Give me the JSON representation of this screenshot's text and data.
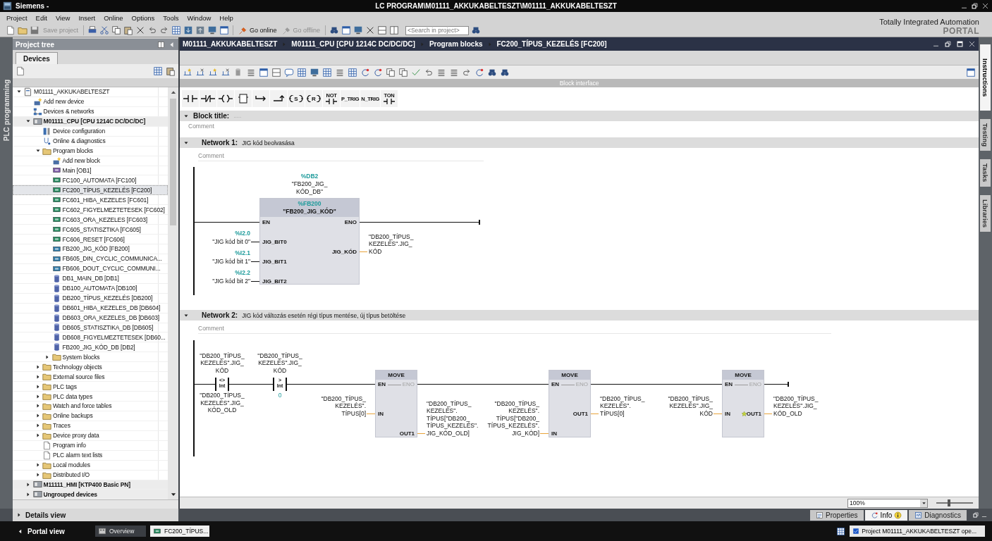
{
  "window": {
    "app": "Siemens -",
    "title": "LC PROGRAM\\M01111_AKKUKABELTESZT\\M01111_AKKUKABELTESZT"
  },
  "menu": [
    "Project",
    "Edit",
    "View",
    "Insert",
    "Online",
    "Options",
    "Tools",
    "Window",
    "Help"
  ],
  "toolbar": {
    "buttons": [
      {
        "label": "Save project",
        "disabled": true
      },
      {
        "label": "Go online",
        "disabled": false
      },
      {
        "label": "Go offline",
        "disabled": true
      }
    ],
    "search": {
      "placeholder": "<Search in project>"
    }
  },
  "brand": {
    "line1": "Totally Integrated Automation",
    "line2": "PORTAL"
  },
  "side_strip": "PLC programming",
  "project_tree": {
    "title": "Project tree",
    "tab": "Devices",
    "items": [
      {
        "label": "M01111_AKKUKABELTESZT",
        "kind": "project",
        "expanded": true,
        "selected": false,
        "children": [
          {
            "label": "Add new device",
            "kind": "add",
            "selected": false
          },
          {
            "label": "Devices & networks",
            "kind": "network",
            "selected": false
          },
          {
            "label": "M01111_CPU [CPU 1214C DC/DC/DC]",
            "kind": "device",
            "expanded": true,
            "selected": false,
            "children": [
              {
                "label": "Device configuration",
                "kind": "config",
                "selected": false
              },
              {
                "label": "Online & diagnostics",
                "kind": "diag",
                "selected": false
              },
              {
                "label": "Program blocks",
                "kind": "folder",
                "expanded": true,
                "selected": false,
                "children": [
                  {
                    "label": "Add new block",
                    "kind": "add",
                    "selected": false
                  },
                  {
                    "label": "Main [OB1]",
                    "kind": "ob",
                    "selected": false
                  },
                  {
                    "label": "FC100_AUTOMATA [FC100]",
                    "kind": "fc",
                    "selected": false
                  },
                  {
                    "label": "FC200_TÍPUS_KEZELÉS [FC200]",
                    "kind": "fc",
                    "selected": true
                  },
                  {
                    "label": "FC601_HIBA_KEZELES [FC601]",
                    "kind": "fc",
                    "selected": false
                  },
                  {
                    "label": "FC602_FIGYELMEZTETESEK [FC602]",
                    "kind": "fc",
                    "selected": false
                  },
                  {
                    "label": "FC603_ORA_KEZELES [FC603]",
                    "kind": "fc",
                    "selected": false
                  },
                  {
                    "label": "FC605_STATISZTIKA [FC605]",
                    "kind": "fc",
                    "selected": false
                  },
                  {
                    "label": "FC606_RESET [FC606]",
                    "kind": "fc",
                    "selected": false
                  },
                  {
                    "label": "FB200_JIG_KÓD [FB200]",
                    "kind": "fb",
                    "selected": false
                  },
                  {
                    "label": "FB605_DIN_CYCLIC_COMMUNICA...",
                    "kind": "fb",
                    "selected": false
                  },
                  {
                    "label": "FB606_DOUT_CYCLIC_COMMUNI...",
                    "kind": "fb",
                    "selected": false
                  },
                  {
                    "label": "DB1_MAIN_DB [DB1]",
                    "kind": "db",
                    "selected": false
                  },
                  {
                    "label": "DB100_AUTOMATA [DB100]",
                    "kind": "db",
                    "selected": false
                  },
                  {
                    "label": "DB200_TÍPUS_KEZELÉS [DB200]",
                    "kind": "db",
                    "selected": false
                  },
                  {
                    "label": "DB601_HIBA_KEZELES_DB [DB604]",
                    "kind": "db",
                    "selected": false
                  },
                  {
                    "label": "DB603_ORA_KEZELES_DB [DB603]",
                    "kind": "db",
                    "selected": false
                  },
                  {
                    "label": "DB605_STATISZTIKA_DB [DB605]",
                    "kind": "db",
                    "selected": false
                  },
                  {
                    "label": "DB608_FIGYELMEZTETESEK [DB60...",
                    "kind": "db",
                    "selected": false
                  },
                  {
                    "label": "FB200_JIG_KÓD_DB [DB2]",
                    "kind": "db",
                    "selected": false
                  },
                  {
                    "label": "System blocks",
                    "kind": "folder",
                    "expanded": false,
                    "selected": false
                  }
                ]
              },
              {
                "label": "Technology objects",
                "kind": "folder",
                "expanded": false,
                "selected": false
              },
              {
                "label": "External source files",
                "kind": "folder",
                "expanded": false,
                "selected": false
              },
              {
                "label": "PLC tags",
                "kind": "folder",
                "expanded": false,
                "selected": false
              },
              {
                "label": "PLC data types",
                "kind": "folder",
                "expanded": false,
                "selected": false
              },
              {
                "label": "Watch and force tables",
                "kind": "folder",
                "expanded": false,
                "selected": false
              },
              {
                "label": "Online backups",
                "kind": "folder",
                "expanded": false,
                "selected": false
              },
              {
                "label": "Traces",
                "kind": "folder",
                "expanded": false,
                "selected": false
              },
              {
                "label": "Device proxy data",
                "kind": "folder",
                "expanded": false,
                "selected": false
              },
              {
                "label": "Program info",
                "kind": "doc",
                "selected": false
              },
              {
                "label": "PLC alarm text lists",
                "kind": "doc",
                "selected": false
              },
              {
                "label": "Local modules",
                "kind": "folder",
                "expanded": false,
                "selected": false
              },
              {
                "label": "Distributed I/O",
                "kind": "folder",
                "expanded": false,
                "selected": false
              }
            ]
          },
          {
            "label": "M11111_HMI [KTP400 Basic PN]",
            "kind": "device",
            "expanded": false,
            "selected": false
          },
          {
            "label": "Ungrouped devices",
            "kind": "group",
            "expanded": false,
            "selected": false
          }
        ]
      }
    ],
    "details_view": {
      "label": "Details view",
      "expanded": false
    }
  },
  "editor": {
    "breadcrumb": [
      "M01111_AKKUKABELTESZT",
      "M01111_CPU [CPU 1214C DC/DC/DC]",
      "Program blocks",
      "FC200_TÍPUS_KEZELÉS [FC200]"
    ],
    "block_interface": "Block interface",
    "favorites": [
      {
        "kind": "contact_no"
      },
      {
        "kind": "contact_nc"
      },
      {
        "kind": "coil"
      },
      {
        "kind": "empty_box"
      },
      {
        "kind": "open_branch"
      },
      {
        "kind": "close_branch"
      },
      {
        "kind": "set_coil",
        "label": "S"
      },
      {
        "kind": "reset_coil",
        "label": "R"
      },
      {
        "kind": "not",
        "label": "NOT"
      },
      {
        "kind": "p_trig",
        "label": "P_TRIG"
      },
      {
        "kind": "n_trig",
        "label": "N_TRIG"
      },
      {
        "kind": "ton",
        "label": "TON"
      }
    ],
    "block_title": {
      "label": "Block title:",
      "value": ".....",
      "expanded": true,
      "comment": {
        "placeholder": "Comment"
      }
    },
    "networks": [
      {
        "label": "Network 1:",
        "title": "JIG kód beolvasása",
        "expanded": true,
        "comment": {
          "placeholder": "Comment"
        },
        "elements": [
          {
            "kind": "fb_box",
            "address": "%FB200",
            "name": "\"FB200_JIG_KÓD\"",
            "instance": {
              "address": "%DB2",
              "lines": [
                "\"FB200_JIG_",
                "KÓD_DB\""
              ]
            },
            "inputs": [
              {
                "pin": "EN"
              },
              {
                "pin": "JIG_BIT0",
                "operand": {
                  "address": "%I2.0",
                  "lines": [
                    "\"JIG kód bit 0\""
                  ],
                  "kind": "bool"
                }
              },
              {
                "pin": "JIG_BIT1",
                "operand": {
                  "address": "%I2.1",
                  "lines": [
                    "\"JIG kód bit 1\""
                  ],
                  "kind": "bool"
                }
              },
              {
                "pin": "JIG_BIT2",
                "operand": {
                  "address": "%I2.2",
                  "lines": [
                    "\"JIG kód bit 2\""
                  ],
                  "kind": "bool"
                }
              }
            ],
            "outputs": [
              {
                "pin": "ENO",
                "disabled": false
              },
              {
                "pin": "JIG_KÓD",
                "operand": {
                  "lines": [
                    "\"DB200_TÍPUS_",
                    "KEZELÉS\".JIG_",
                    "KÓD"
                  ],
                  "kind": "int"
                }
              }
            ]
          }
        ]
      },
      {
        "label": "Network 2:",
        "title": "JIG kód változás esetén régi típus mentése, új típus betöltése",
        "expanded": true,
        "comment": {
          "placeholder": "Comment"
        },
        "elements": [
          {
            "kind": "compare",
            "op": "<>",
            "type": "Int",
            "top": {
              "lines": [
                "\"DB200_TÍPUS_",
                "KEZELÉS\".JIG_",
                "KÓD"
              ],
              "kind": "tag"
            },
            "bottom": {
              "lines": [
                "\"DB200_TÍPUS_",
                "KEZELÉS\".JIG_",
                "KÓD_OLD"
              ],
              "kind": "tag"
            }
          },
          {
            "kind": "compare",
            "op": ">",
            "type": "Int",
            "top": {
              "lines": [
                "\"DB200_TÍPUS_",
                "KEZELÉS\".JIG_",
                "KÓD"
              ],
              "kind": "tag"
            },
            "bottom": {
              "lines": [
                "0"
              ],
              "kind": "constant"
            }
          },
          {
            "kind": "move_box",
            "title": "MOVE",
            "inputs": [
              {
                "pin": "EN"
              },
              {
                "pin": "IN",
                "operand": {
                  "lines": [
                    "\"DB200_TÍPUS_",
                    "KEZELÉS\".",
                    "TÍPUS[0]"
                  ],
                  "kind": "int"
                }
              }
            ],
            "outputs": [
              {
                "pin": "ENO",
                "disabled": true
              },
              {
                "pin": "OUT1",
                "operand": {
                  "lines": [
                    "\"DB200_TÍPUS_",
                    "KEZELÉS\".",
                    "TÍPUS[\"DB200_",
                    "TÍPUS_KEZELÉS\".",
                    "JIG_KÓD_OLD]"
                  ],
                  "kind": "int"
                }
              }
            ]
          },
          {
            "kind": "move_box",
            "title": "MOVE",
            "inputs": [
              {
                "pin": "EN"
              },
              {
                "pin": "IN",
                "operand": {
                  "lines": [
                    "\"DB200_TÍPUS_",
                    "KEZELÉS\".",
                    "TÍPUS[\"DB200_",
                    "TÍPUS_KEZELÉS\".",
                    "JIG_KÓD]"
                  ],
                  "kind": "int"
                }
              }
            ],
            "outputs": [
              {
                "pin": "ENO",
                "disabled": true
              },
              {
                "pin": "OUT1",
                "operand": {
                  "lines": [
                    "\"DB200_TÍPUS_",
                    "KEZELÉS\".",
                    "TÍPUS[0]"
                  ],
                  "kind": "int"
                }
              }
            ]
          },
          {
            "kind": "move_box",
            "title": "MOVE",
            "inputs": [
              {
                "pin": "EN"
              },
              {
                "pin": "IN",
                "operand": {
                  "lines": [
                    "\"DB200_TÍPUS_",
                    "KEZELÉS\".JIG_",
                    "KÓD"
                  ],
                  "kind": "int"
                }
              }
            ],
            "outputs": [
              {
                "pin": "ENO",
                "disabled": true
              },
              {
                "pin": "OUT1",
                "expandable": true,
                "operand": {
                  "lines": [
                    "\"DB200_TÍPUS_",
                    "KEZELÉS\".JIG_",
                    "KÓD_OLD"
                  ],
                  "kind": "int"
                }
              }
            ]
          }
        ]
      }
    ],
    "zoom": {
      "value": "100%",
      "level": 0.35
    }
  },
  "right_tabs": [
    {
      "label": "Instructions",
      "selected": true
    },
    {
      "label": "Testing",
      "selected": false
    },
    {
      "label": "Tasks",
      "selected": false
    },
    {
      "label": "Libraries",
      "selected": false
    }
  ],
  "inspector_tabs": [
    {
      "label": "Properties",
      "selected": false
    },
    {
      "label": "Info",
      "selected": true
    },
    {
      "label": "Diagnostics",
      "selected": false
    }
  ],
  "taskbar": {
    "portal_view": "Portal view",
    "tasks": [
      {
        "label": "Overview",
        "selected": false
      },
      {
        "label": "FC200_TÍPUS...",
        "selected": true
      }
    ],
    "status": "Project M01111_AKKUKABELTESZT ope..."
  }
}
